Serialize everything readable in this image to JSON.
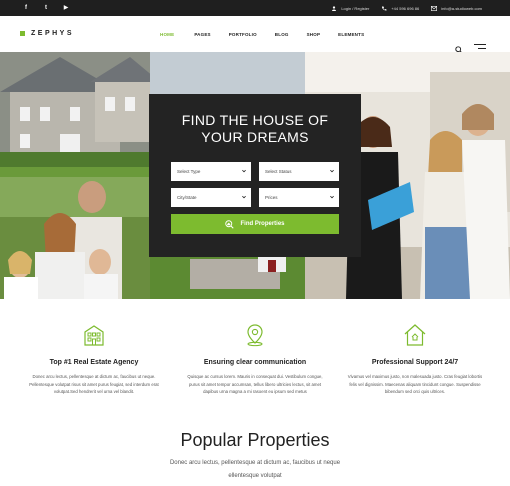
{
  "topbar": {
    "social": [
      {
        "icon": "facebook-icon",
        "glyph": "f"
      },
      {
        "icon": "twitter-icon",
        "glyph": "t"
      },
      {
        "icon": "youtube-icon",
        "glyph": "▶"
      }
    ],
    "login_label": "Login / Register",
    "phone": "+44 596 696 86",
    "email": "info@a-studioweb.com"
  },
  "nav": {
    "logo_text": "ZEPHYS",
    "items": [
      "HOME",
      "PAGES",
      "PORTFOLIO",
      "BLOG",
      "SHOP",
      "ELEMENTS"
    ],
    "active_index": 0
  },
  "hero": {
    "title_line1": "FIND THE HOUSE OF",
    "title_line2": "YOUR DREAMS",
    "fields": [
      "Select Type",
      "Select Status",
      "City/State",
      "Prices"
    ],
    "button_label": "Find Properties"
  },
  "features": [
    {
      "icon": "building-icon",
      "title": "Top #1 Real Estate Agency",
      "text": "Donec arcu lectus, pellentesque at dictum ac, faucibus ut neque. Pellentesque volutpat risus sit amet purus feugiat, sed interdum erat volutpat.Sed hendrerit vel urna vel blandit."
    },
    {
      "icon": "location-pin-icon",
      "title": "Ensuring clear communication",
      "text": "Quisque ac cursus lorem. Mauris in consequat dui. Vestibulum congue, purus sit amet tempor accumsan, tellus libero ultricies lectus, sit amet dapibus urna magna a mi rasoent eu ipsum sed metus"
    },
    {
      "icon": "house-icon",
      "title": "Professional Support 24/7",
      "text": "Vivamus vel maximus justo, non malesuada justo. Cras feugiat lobortis felis vel dignissim. Maecenas aliquam tincidunt congue. Suspendisse bibendum sed orci quis ultrices."
    }
  ],
  "popular": {
    "title": "Popular Properties",
    "line1": "Donec arcu lectus, pellentesque at dictum ac, faucibus ut neque",
    "line2": "ellentesque volutpat"
  },
  "colors": {
    "accent": "#7dbb2f",
    "topbar": "#1f1f1f",
    "search_panel": "#232323"
  }
}
